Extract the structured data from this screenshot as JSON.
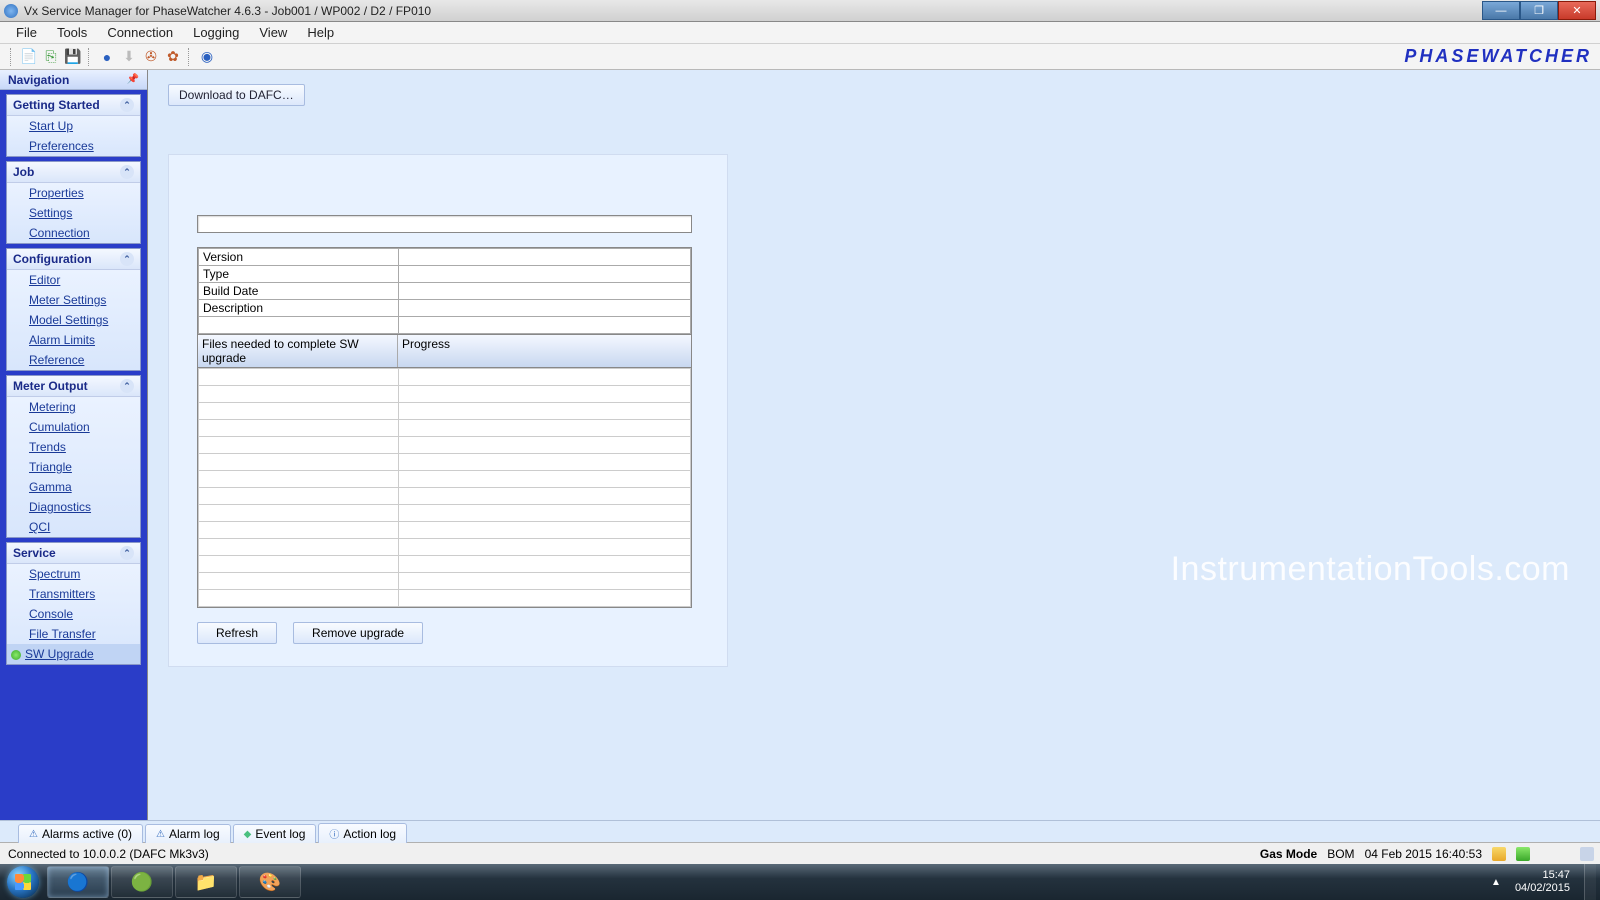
{
  "titlebar": {
    "text": "Vx Service Manager for PhaseWatcher 4.6.3 - Job001 / WP002 / D2 / FP010"
  },
  "menu": [
    "File",
    "Tools",
    "Connection",
    "Logging",
    "View",
    "Help"
  ],
  "toolbar": {
    "icons": [
      {
        "name": "new-doc-icon",
        "glyph": "📄",
        "color": ""
      },
      {
        "name": "open-icon",
        "glyph": "📂",
        "color": "#3a9a3a"
      },
      {
        "name": "save-icon",
        "glyph": "💾",
        "color": "#2a60c0"
      },
      {
        "name": "refresh-icon",
        "glyph": "🔄",
        "color": "#2a60c0"
      },
      {
        "name": "download-icon",
        "glyph": "⬇",
        "color": "#999"
      },
      {
        "name": "upload-icon",
        "glyph": "⬆",
        "color": "#c05a2a"
      },
      {
        "name": "gear-icon",
        "glyph": "✿",
        "color": "#c05a2a"
      },
      {
        "name": "help-icon",
        "glyph": "❔",
        "color": "#2a60c0"
      }
    ]
  },
  "brand": "PHASEWATCHER",
  "nav": {
    "title": "Navigation",
    "groups": [
      {
        "title": "Getting Started",
        "items": [
          "Start Up",
          "Preferences"
        ]
      },
      {
        "title": "Job",
        "items": [
          "Properties",
          "Settings",
          "Connection"
        ]
      },
      {
        "title": "Configuration",
        "items": [
          "Editor",
          "Meter Settings",
          "Model Settings",
          "Alarm Limits",
          "Reference"
        ]
      },
      {
        "title": "Meter Output",
        "items": [
          "Metering",
          "Cumulation",
          "Trends",
          "Triangle",
          "Gamma",
          "Diagnostics",
          "QCI"
        ]
      },
      {
        "title": "Service",
        "items": [
          "Spectrum",
          "Transmitters",
          "Console",
          "File Transfer",
          "SW Upgrade"
        ],
        "activeIndex": 4
      }
    ]
  },
  "content": {
    "download_btn": "Download to DAFC…",
    "info_rows": [
      "Version",
      "Type",
      "Build Date",
      "Description"
    ],
    "progress_headers": [
      "Files needed to complete SW upgrade",
      "Progress"
    ],
    "refresh_btn": "Refresh",
    "remove_btn": "Remove upgrade"
  },
  "watermark": "InstrumentationTools.com",
  "bottom_tabs": [
    {
      "icon": "⚠",
      "label": "Alarms active (0)"
    },
    {
      "icon": "⚠",
      "label": "Alarm log"
    },
    {
      "icon": "◆",
      "label": "Event log"
    },
    {
      "icon": "ⓘ",
      "label": "Action log"
    }
  ],
  "status": {
    "connected": "Connected to 10.0.0.2 (DAFC Mk3v3)",
    "mode": "Gas Mode",
    "bom": "BOM",
    "timestamp": "04 Feb 2015 16:40:53"
  },
  "tray": {
    "time": "15:47",
    "date": "04/02/2015"
  }
}
